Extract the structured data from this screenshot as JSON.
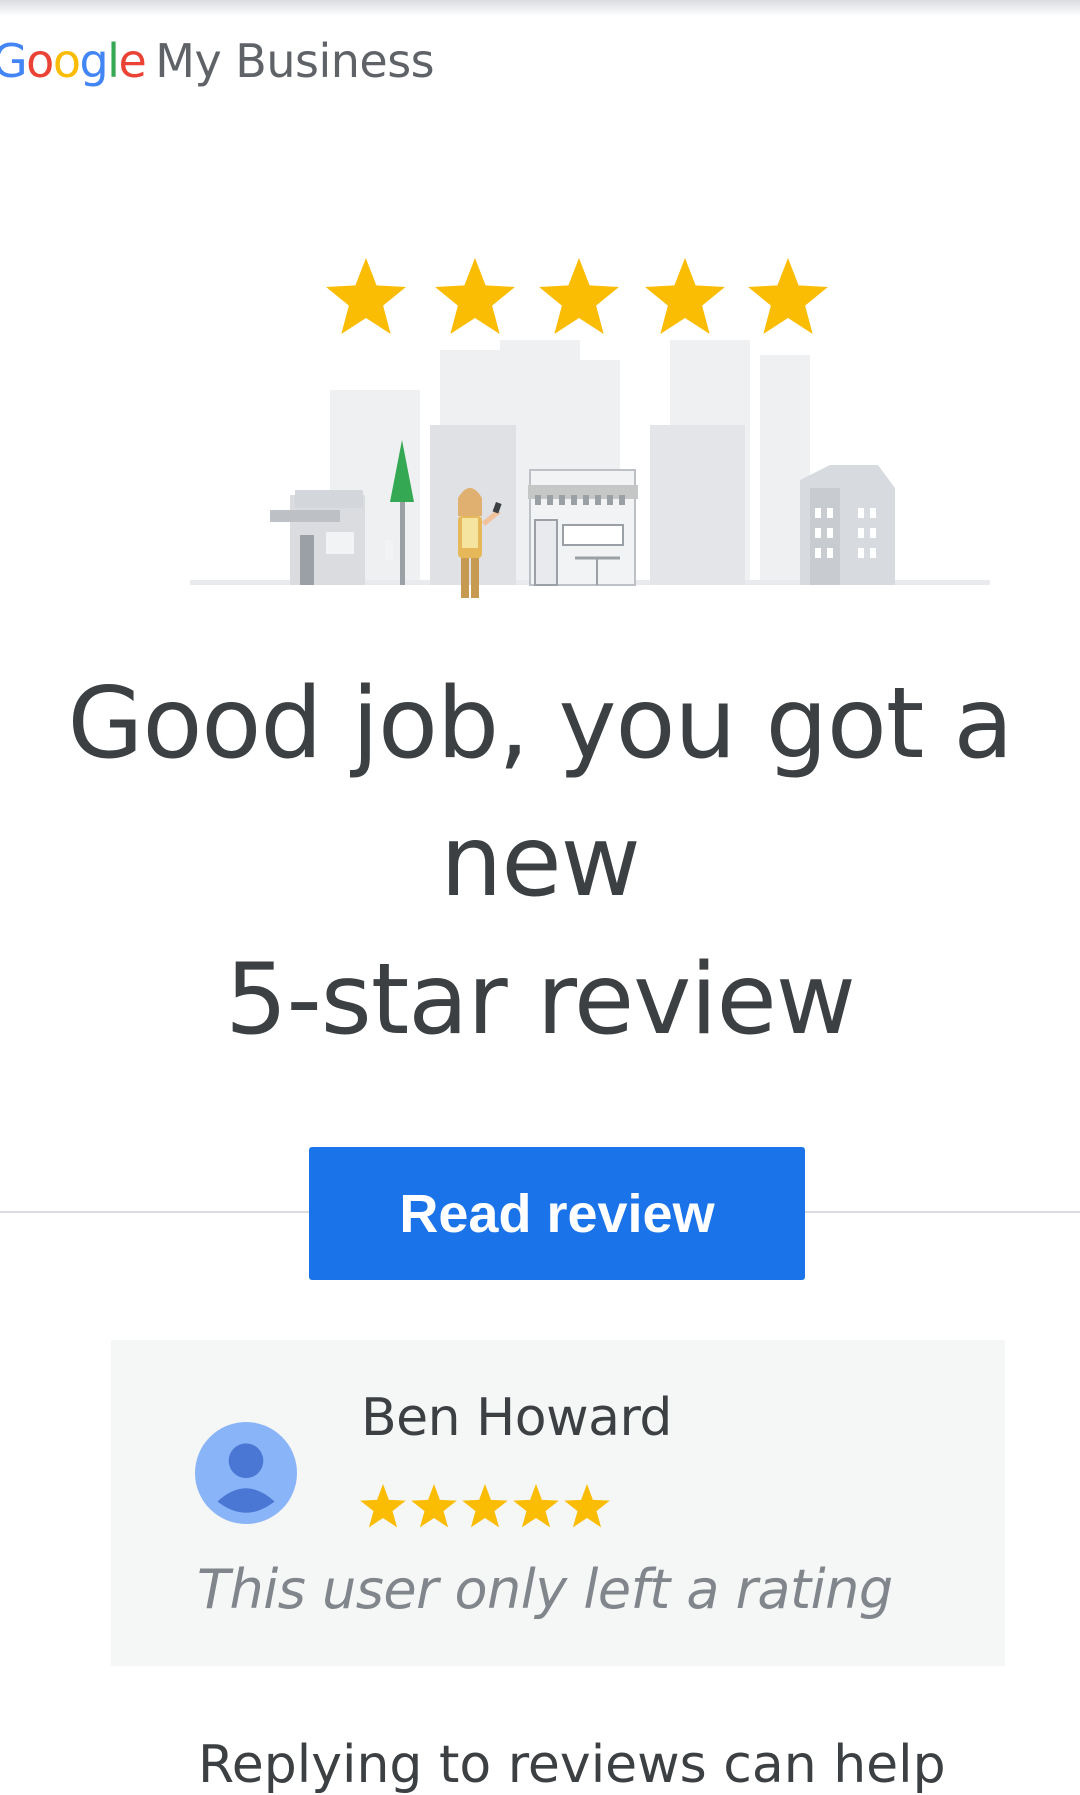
{
  "header": {
    "logo_google_letters": [
      "G",
      "o",
      "o",
      "g",
      "l",
      "e"
    ],
    "logo_google_colors": [
      "#4285F4",
      "#EA4335",
      "#FBBC05",
      "#4285F4",
      "#34A853",
      "#EA4335"
    ],
    "logo_product": "My Business"
  },
  "hero": {
    "star_count": 5,
    "star_color": "#FBBC04",
    "illustration": "town-street-illustration"
  },
  "headline": {
    "line1": "Good job, you got a",
    "line2": "new",
    "line3": "5-star review"
  },
  "cta": {
    "label": "Read review",
    "color": "#1A73E8"
  },
  "review": {
    "reviewer_name": "Ben Howard",
    "rating": 5,
    "rating_note": "This user only left a rating",
    "avatar_icon": "person-icon"
  },
  "body": {
    "text": "Replying to reviews can help"
  }
}
